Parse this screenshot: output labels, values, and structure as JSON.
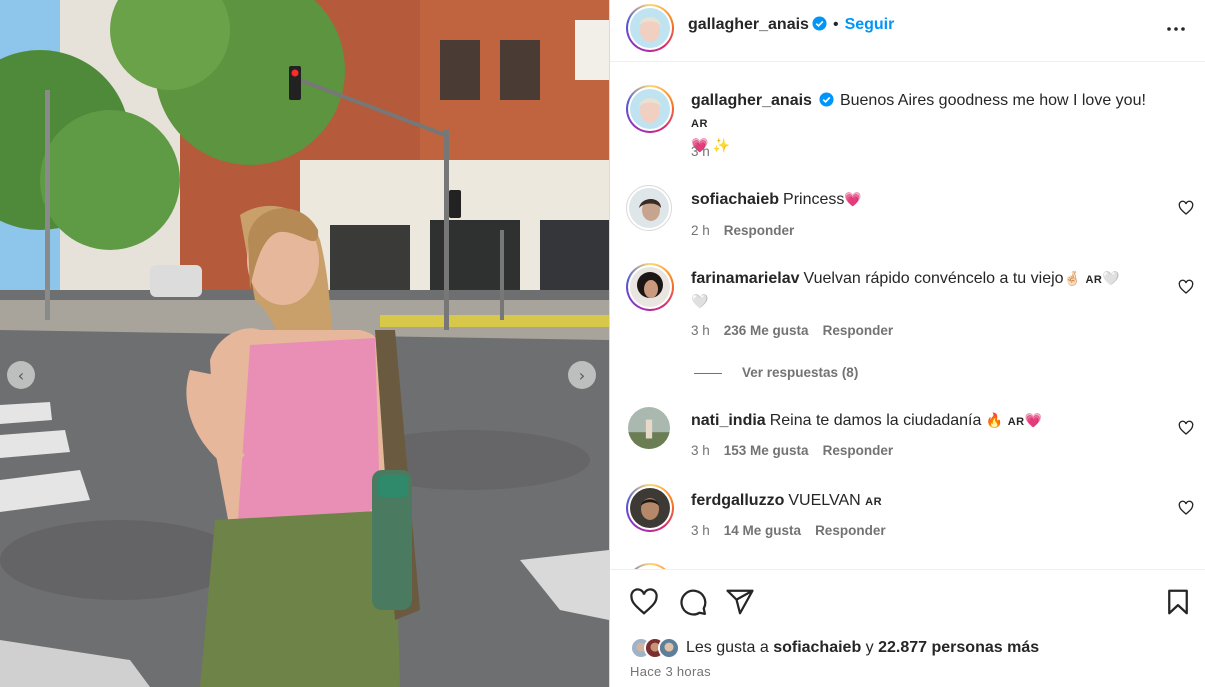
{
  "post_image": {
    "description_icon": "street-photo",
    "prev_icon": "chevron-left-icon",
    "next_icon": "chevron-right-icon"
  },
  "header": {
    "username": "gallagher_anais",
    "separator": "•",
    "follow_label": "Seguir",
    "more_icon": "more-horizontal-icon"
  },
  "caption": {
    "username": "gallagher_anais",
    "text": "Buenos Aires goodness me how I love you!",
    "flag": "AR",
    "emojis": "💗 ✨",
    "time": "3 h"
  },
  "comments": [
    {
      "username": "sofiachaieb",
      "text": "Princess",
      "emoji_after": "💗",
      "time": "2 h",
      "likes": "",
      "reply_label": "Responder"
    },
    {
      "username": "farinamarielav",
      "text": "Vuelvan rápido convéncelo a tu viejo",
      "emoji_after": "🤞🏻",
      "flag": "AR",
      "emoji_tail": "🤍",
      "emoji_line2": "🤍",
      "time": "3 h",
      "likes": "236 Me gusta",
      "reply_label": "Responder",
      "view_replies": "Ver respuestas (8)"
    },
    {
      "username": "nati_india",
      "text": "Reina te damos la ciudadanía",
      "emoji_after": "🔥",
      "flag": "AR",
      "emoji_tail": "💗",
      "time": "3 h",
      "likes": "153 Me gusta",
      "reply_label": "Responder"
    },
    {
      "username": "ferdgalluzzo",
      "text": "VUELVAN",
      "flag": "AR",
      "time": "3 h",
      "likes": "14 Me gusta",
      "reply_label": "Responder"
    }
  ],
  "actions": {
    "like_icon": "heart-icon",
    "comment_icon": "comment-icon",
    "share_icon": "send-icon",
    "save_icon": "bookmark-icon"
  },
  "likes": {
    "prefix": "Les gusta a",
    "user": "sofiachaieb",
    "conj": "y",
    "count": "22.877 personas más"
  },
  "timestamp": "Hace 3 horas",
  "colors": {
    "accent": "#0095f6",
    "verified": "#0095f6",
    "muted": "#737373"
  }
}
